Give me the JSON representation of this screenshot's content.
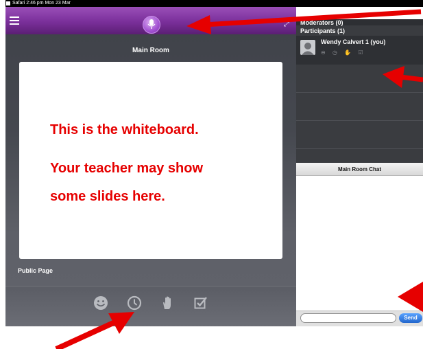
{
  "status_bar": {
    "text": "Safari  2:46 pm   Mon 23 Mar"
  },
  "main_room": {
    "title": "Main Room",
    "whiteboard_lines": [
      "This is the whiteboard.",
      "Your teacher may show",
      "some slides here."
    ],
    "page_label": "Public Page",
    "toolbar_icons": [
      "emoji-icon",
      "clock-icon",
      "raise-hand-icon",
      "checkbox-icon"
    ]
  },
  "users": {
    "moderators_label": "Moderators (0)",
    "participants_label": "Participants (1)",
    "participants": [
      {
        "name": "Wendy Calvert 1 (you)",
        "status_icons": "⊖ ◷ ✋ ☑"
      }
    ]
  },
  "chat": {
    "title": "Main Room Chat",
    "input_value": "",
    "send_label": "Send"
  },
  "colors": {
    "accent_purple": "#7a2f9a",
    "annotation_red": "#e60000",
    "whiteboard_text": "#e60000"
  }
}
